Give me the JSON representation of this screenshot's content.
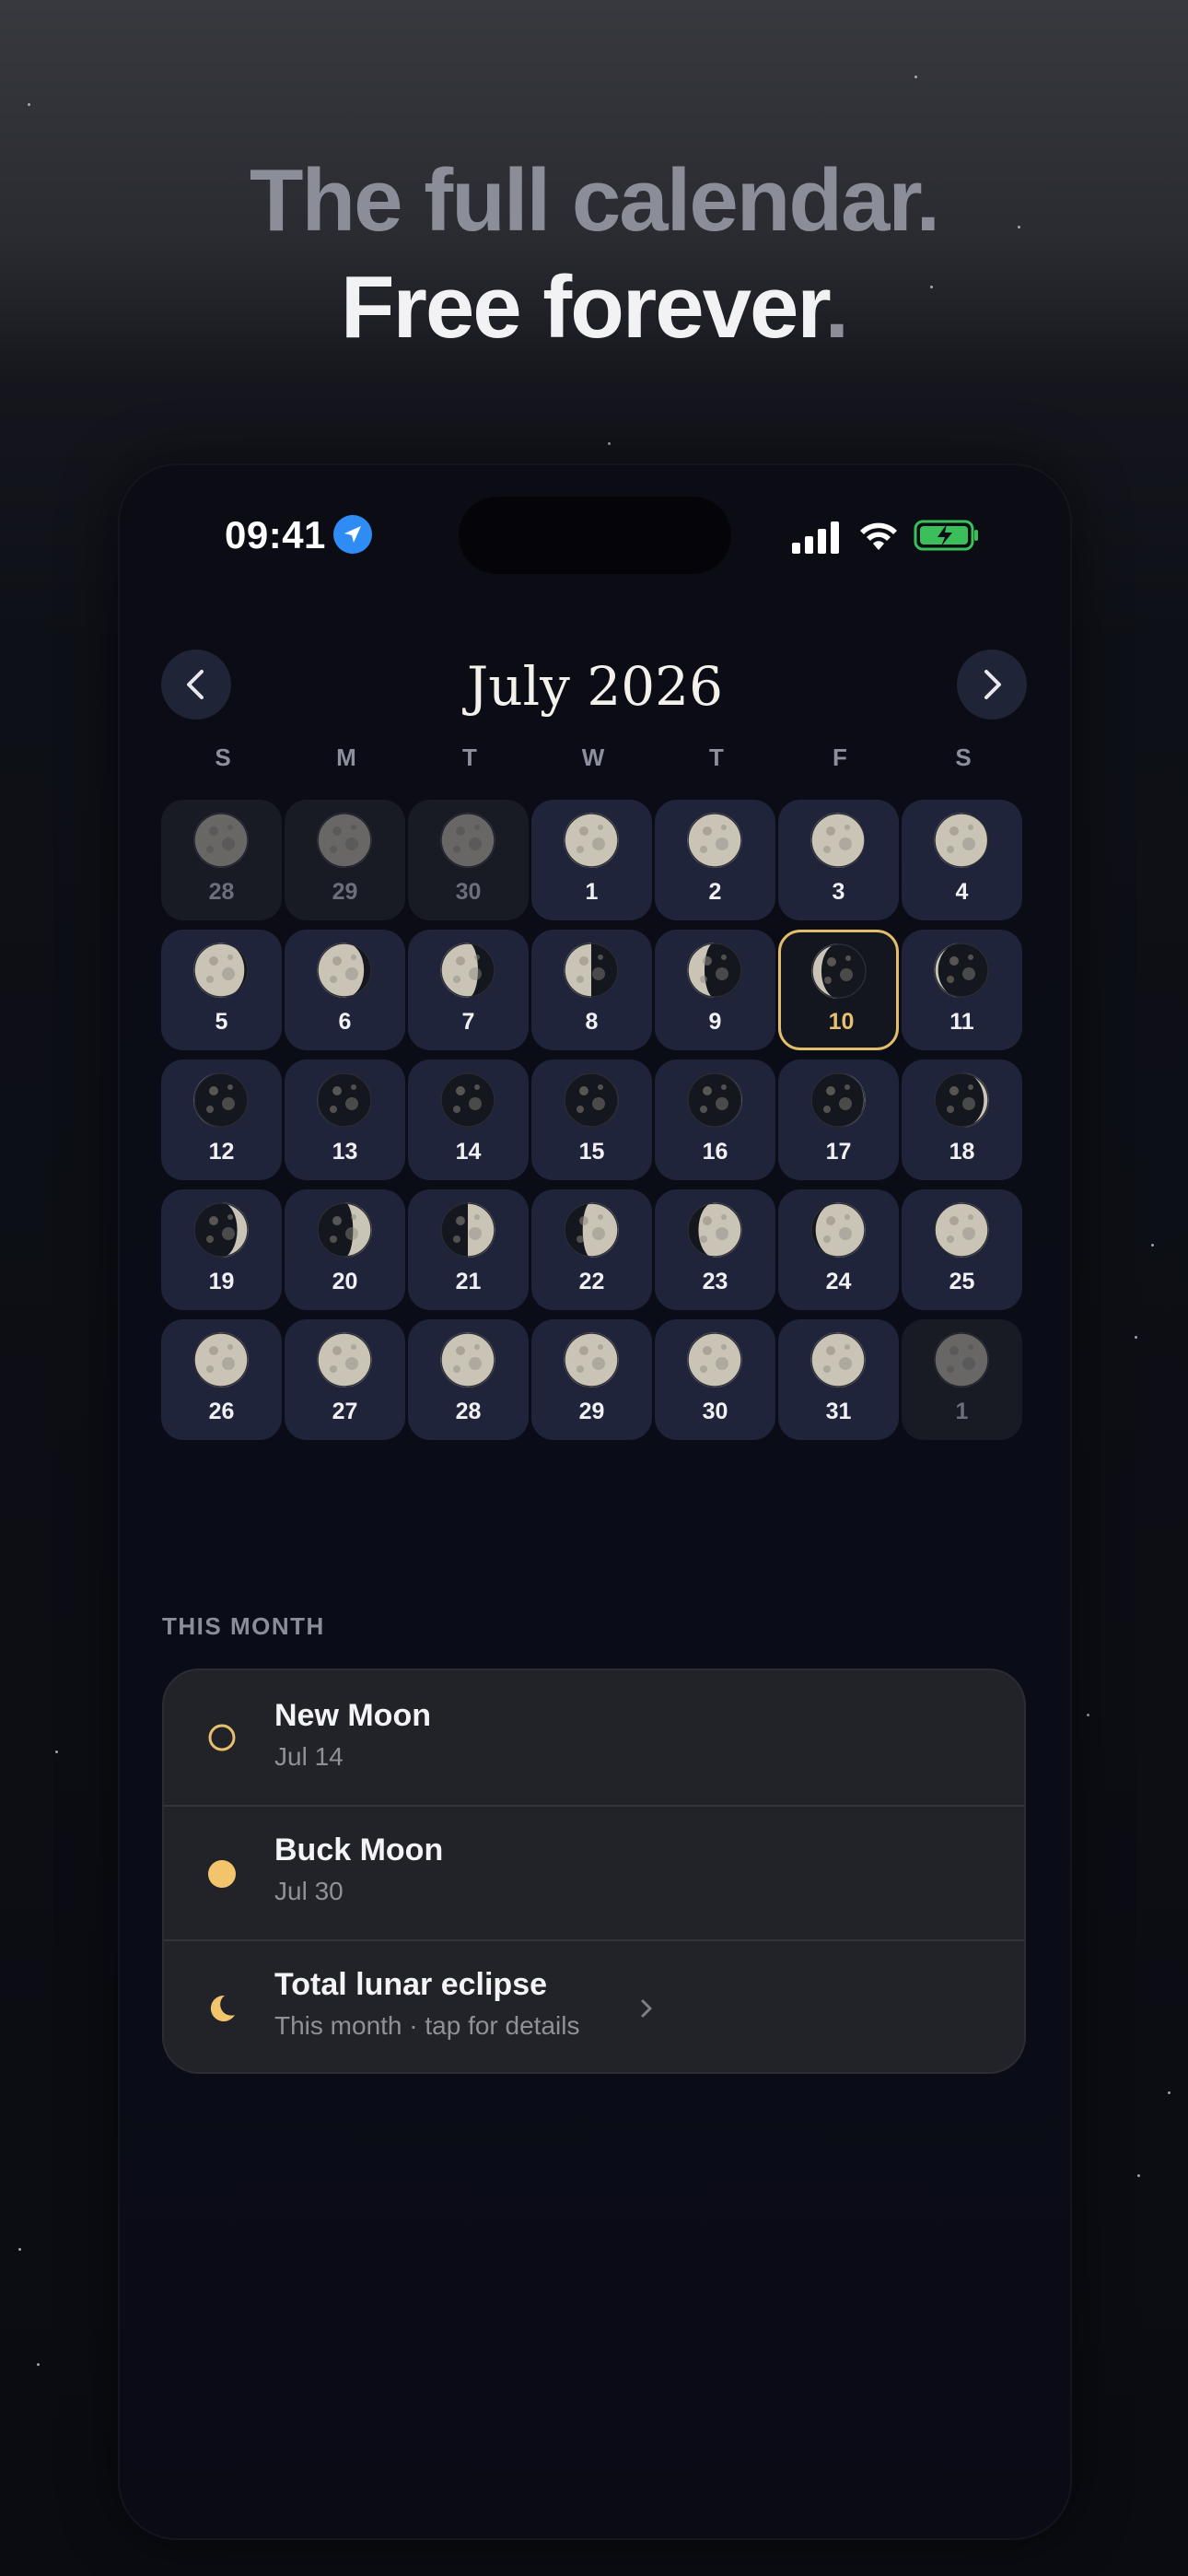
{
  "headline": {
    "line1": "The full calendar.",
    "line2_main": "Free forever",
    "line2_dot": "."
  },
  "status_bar": {
    "time": "09:41"
  },
  "calendar": {
    "month_title": "July 2026",
    "weekdays": [
      "S",
      "M",
      "T",
      "W",
      "T",
      "F",
      "S"
    ],
    "days": [
      {
        "n": "28",
        "dim": true,
        "phase": 1.0
      },
      {
        "n": "29",
        "dim": true,
        "phase": 1.0
      },
      {
        "n": "30",
        "dim": true,
        "phase": 1.0
      },
      {
        "n": "1",
        "phase": 1.0
      },
      {
        "n": "2",
        "phase": 0.97
      },
      {
        "n": "3",
        "phase": 0.94
      },
      {
        "n": "4",
        "phase": 0.88
      },
      {
        "n": "5",
        "phase": 0.82
      },
      {
        "n": "6",
        "phase": 0.75
      },
      {
        "n": "7",
        "phase": 0.62
      },
      {
        "n": "8",
        "phase": 0.5
      },
      {
        "n": "9",
        "phase": 0.38
      },
      {
        "n": "10",
        "phase": 0.28,
        "today": true
      },
      {
        "n": "11",
        "phase": 0.18
      },
      {
        "n": "12",
        "phase": 0.1
      },
      {
        "n": "13",
        "phase": 0.04
      },
      {
        "n": "14",
        "phase": 0.0
      },
      {
        "n": "15",
        "phase": 0.02
      },
      {
        "n": "16",
        "phase": 0.06
      },
      {
        "n": "17",
        "phase": 0.12
      },
      {
        "n": "18",
        "phase": 0.2
      },
      {
        "n": "19",
        "phase": 0.3
      },
      {
        "n": "20",
        "phase": 0.4
      },
      {
        "n": "21",
        "phase": 0.5
      },
      {
        "n": "22",
        "phase": 0.6
      },
      {
        "n": "23",
        "phase": 0.7
      },
      {
        "n": "24",
        "phase": 0.8
      },
      {
        "n": "25",
        "phase": 0.9
      },
      {
        "n": "26",
        "phase": 0.95
      },
      {
        "n": "27",
        "phase": 0.97
      },
      {
        "n": "28",
        "phase": 0.99
      },
      {
        "n": "29",
        "phase": 1.0
      },
      {
        "n": "30",
        "phase": 1.0
      },
      {
        "n": "31",
        "phase": 1.0
      },
      {
        "n": "1",
        "dim": true,
        "phase": 0.98
      }
    ]
  },
  "this_month": {
    "label": "THIS MONTH",
    "events": [
      {
        "title": "New Moon",
        "subtitle": "Jul 14",
        "icon": "new-moon-outline-icon"
      },
      {
        "title": "Buck Moon",
        "subtitle": "Jul 30",
        "icon": "full-moon-dot-icon"
      },
      {
        "title": "Total lunar eclipse",
        "subtitle": "This month · tap for details",
        "icon": "crescent-moon-icon"
      }
    ]
  },
  "colors": {
    "accent": "#e6c06e",
    "cell": "#1f243a",
    "card": "#222328"
  }
}
